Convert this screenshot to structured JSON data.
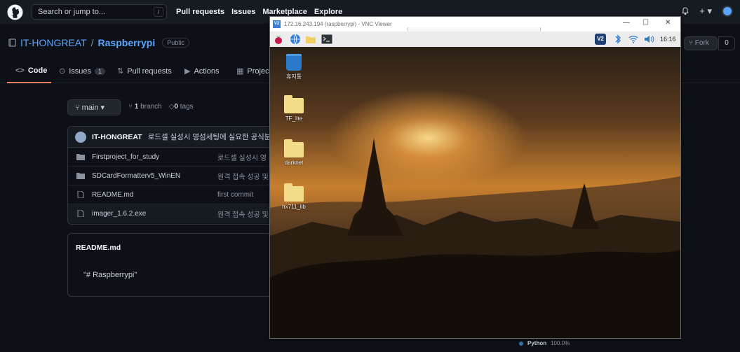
{
  "github": {
    "search_placeholder": "Search or jump to...",
    "search_shortcut": "/",
    "nav": [
      "Pull requests",
      "Issues",
      "Marketplace",
      "Explore"
    ],
    "notification_icon": "bell-icon",
    "plus_label": "+ ▾",
    "owner": "IT-HONGREAT",
    "separator": "/",
    "repo": "Raspberrypi",
    "visibility": "Public",
    "fork_label": "Fork",
    "fork_count": "0",
    "tabs": {
      "code": "Code",
      "issues": "Issues",
      "issues_count": "1",
      "pulls": "Pull requests",
      "actions": "Actions",
      "projects": "Projects"
    },
    "branch": "main",
    "branch_count": "1",
    "branch_word": "branch",
    "tag_count": "0",
    "tag_word": "tags",
    "commit": {
      "author": "IT-HONGREAT",
      "message": "로드셀 실성시 영섬세팅에 실요한 공식분"
    },
    "files": [
      {
        "name": "Firstproject_for_study",
        "type": "folder",
        "message": "로드셀 실성시 영"
      },
      {
        "name": "SDCardFormatterv5_WinEN",
        "type": "folder",
        "message": "원격 접속 성공 및"
      },
      {
        "name": "README.md",
        "type": "file",
        "message": "first commit"
      },
      {
        "name": "imager_1.6.2.exe",
        "type": "file",
        "message": "원격 접속 성공 및"
      }
    ],
    "readme_title": "README.md",
    "readme_body": "\"# Raspberrypi\"",
    "language_name": "Python",
    "language_percent": "100.0%"
  },
  "vnc": {
    "title": "172.16.243.194 (raspberrypi) - VNC Viewer",
    "app_icon_label": "V2",
    "minimize": "—",
    "maximize": "☐",
    "close": "✕",
    "clock": "16:16",
    "desktop_icons": [
      {
        "label": "휴지통",
        "kind": "trash"
      },
      {
        "label": "TF_lite",
        "kind": "folder"
      },
      {
        "label": "darknet",
        "kind": "folder"
      },
      {
        "label": "hx711_lib",
        "kind": "folder"
      }
    ]
  }
}
